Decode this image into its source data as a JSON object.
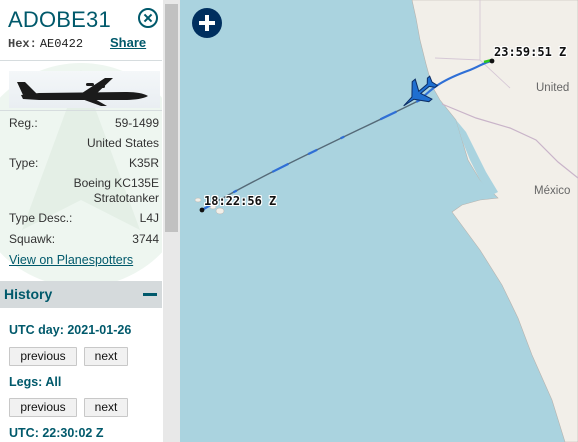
{
  "aircraft": {
    "callsign": "ADOBE31",
    "hex_label": "Hex:",
    "hex_value": "AE0422",
    "share_label": "Share",
    "details": [
      {
        "label": "Reg.:",
        "value": "59-1499"
      },
      {
        "label": "",
        "value": "United States"
      },
      {
        "label": "Type:",
        "value": "K35R"
      },
      {
        "label": "",
        "value": "Boeing KC135E Stratotanker"
      },
      {
        "label": "Type Desc.:",
        "value": "L4J"
      },
      {
        "label": "Squawk:",
        "value": "3744"
      }
    ],
    "planespotters_link": "View on Planespotters"
  },
  "history": {
    "title": "History",
    "utc_day": "UTC day: 2021-01-26",
    "legs": "Legs: All",
    "utc_time": "UTC: 22:30:02 Z",
    "previous_label": "previous",
    "next_label": "next"
  },
  "map": {
    "start_label": "18:22:56 Z",
    "end_label": "23:59:51 Z",
    "places": [
      "United",
      "México"
    ]
  },
  "colors": {
    "accent": "#00596b",
    "water": "#aad3df",
    "land": "#f2efe9",
    "track_blue": "#2f6fd6",
    "track_gray": "#556a78",
    "track_green": "#2ec61f",
    "aircraft_icon": "#1f6fd1"
  },
  "icons": [
    "close-icon",
    "collapse-icon",
    "zoom-in-icon",
    "aircraft-icon",
    "silhouette-icon"
  ]
}
